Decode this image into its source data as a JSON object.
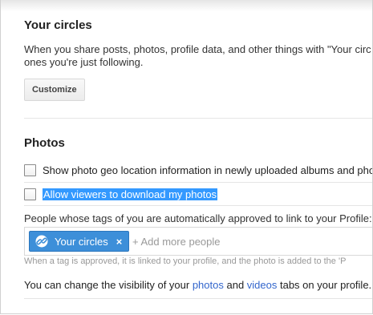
{
  "circles_section": {
    "heading": "Your circles",
    "description_line1": "When you share posts, photos, profile data, and other things with \"Your circ",
    "description_line2": "ones you're just following.",
    "customize_button": "Customize"
  },
  "photos_section": {
    "heading": "Photos",
    "geo_location_checkbox": {
      "label": "Show photo geo location information in newly uploaded albums and phot",
      "checked": false
    },
    "allow_download_checkbox": {
      "label": "Allow viewers to download my photos",
      "checked": false,
      "selected_text": true
    },
    "tag_approval_label": "People whose tags of you are automatically approved to link to your Profile:",
    "tag_chip": {
      "label": "Your circles",
      "remove": "×",
      "icon": "circles-link-icon"
    },
    "add_more_placeholder": "+ Add more people",
    "tag_hint": "When a tag is approved, it is linked to your profile, and the photo is added to the 'P",
    "visibility_text_before": "You can change the visibility of your ",
    "visibility_link_photos": "photos",
    "visibility_text_and": " and ",
    "visibility_link_videos": "videos",
    "visibility_text_after": " tabs on your profile."
  },
  "colors": {
    "accent_blue": "#3d8fd9",
    "link_blue": "#3366cc",
    "selection_blue": "#3399ff"
  }
}
